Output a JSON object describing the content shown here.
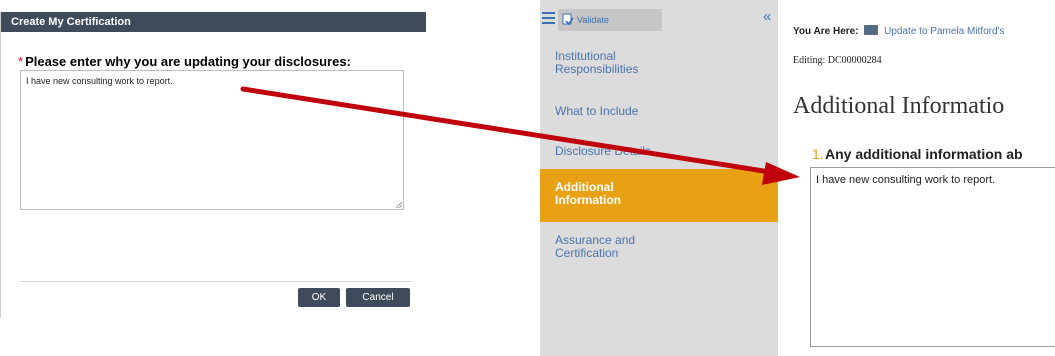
{
  "dialog": {
    "title": "Create My Certification",
    "required_marker": "*",
    "question": "Please enter why you are updating your disclosures:",
    "textarea_value": "I have new consulting work to report.",
    "ok_label": "OK",
    "cancel_label": "Cancel"
  },
  "sidebar": {
    "menu_icon": "hamburger-menu-icon",
    "validate_label": "Validate",
    "collapse_icon": "double-chevron-left-icon",
    "collapse_glyph": "«",
    "items": [
      {
        "label": "Institutional Responsibilities",
        "active": false
      },
      {
        "label": "What to Include",
        "active": false
      },
      {
        "label": "Disclosure Details",
        "active": false
      },
      {
        "label": "Additional Information",
        "active": true
      },
      {
        "label": "Assurance and Certification",
        "active": false
      }
    ]
  },
  "main": {
    "breadcrumb_label": "You Are Here:",
    "breadcrumb_link": "Update to Pamela Mitford's",
    "editing": "Editing: DC00000284",
    "heading": "Additional Informatio",
    "question_number": "1.",
    "question_text": "Any additional information ab",
    "textarea_value": "I have new consulting work to report."
  },
  "colors": {
    "dialog_header": "#3e4b5a",
    "active_nav": "#e8a114",
    "link": "#4a72b0",
    "arrow": "#c0000a"
  }
}
